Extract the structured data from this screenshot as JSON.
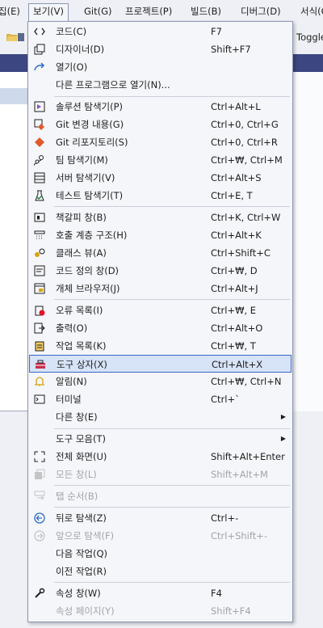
{
  "menubar": {
    "items": [
      {
        "label": "집(E)"
      },
      {
        "label": "보기(V)"
      },
      {
        "label": "Git(G)"
      },
      {
        "label": "프로젝트(P)"
      },
      {
        "label": "빌드(B)"
      },
      {
        "label": "디버그(D)"
      },
      {
        "label": "서식(O)"
      }
    ]
  },
  "toolbar": {
    "toggle_label": "Toggle"
  },
  "menu": {
    "items": [
      {
        "icon": "code-icon",
        "label": "코드(C)",
        "shortcut": "F7"
      },
      {
        "icon": "designer-icon",
        "label": "디자이너(D)",
        "shortcut": "Shift+F7"
      },
      {
        "icon": "open-icon",
        "label": "열기(O)",
        "shortcut": ""
      },
      {
        "icon": "",
        "label": "다른 프로그램으로 열기(N)...",
        "shortcut": ""
      },
      {
        "icon": "solution-explorer-icon",
        "label": "솔루션 탐색기(P)",
        "shortcut": "Ctrl+Alt+L"
      },
      {
        "icon": "git-changes-icon",
        "label": "Git 변경 내용(G)",
        "shortcut": "Ctrl+0, Ctrl+G"
      },
      {
        "icon": "git-repository-icon",
        "label": "Git 리포지토리(S)",
        "shortcut": "Ctrl+0, Ctrl+R"
      },
      {
        "icon": "team-explorer-icon",
        "label": "팀 탐색기(M)",
        "shortcut": "Ctrl+₩, Ctrl+M"
      },
      {
        "icon": "server-explorer-icon",
        "label": "서버 탐색기(V)",
        "shortcut": "Ctrl+Alt+S"
      },
      {
        "icon": "test-explorer-icon",
        "label": "테스트 탐색기(T)",
        "shortcut": "Ctrl+E, T"
      },
      {
        "icon": "bookmark-window-icon",
        "label": "책갈피 창(B)",
        "shortcut": "Ctrl+K, Ctrl+W"
      },
      {
        "icon": "call-hierarchy-icon",
        "label": "호출 계층 구조(H)",
        "shortcut": "Ctrl+Alt+K"
      },
      {
        "icon": "class-view-icon",
        "label": "클래스 뷰(A)",
        "shortcut": "Ctrl+Shift+C"
      },
      {
        "icon": "code-definition-icon",
        "label": "코드 정의 창(D)",
        "shortcut": "Ctrl+₩, D"
      },
      {
        "icon": "object-browser-icon",
        "label": "개체 브라우저(J)",
        "shortcut": "Ctrl+Alt+J"
      },
      {
        "icon": "error-list-icon",
        "label": "오류 목록(I)",
        "shortcut": "Ctrl+₩, E"
      },
      {
        "icon": "output-icon",
        "label": "출력(O)",
        "shortcut": "Ctrl+Alt+O"
      },
      {
        "icon": "task-list-icon",
        "label": "작업 목록(K)",
        "shortcut": "Ctrl+₩, T"
      },
      {
        "icon": "toolbox-icon",
        "label": "도구 상자(X)",
        "shortcut": "Ctrl+Alt+X"
      },
      {
        "icon": "notifications-icon",
        "label": "알림(N)",
        "shortcut": "Ctrl+₩, Ctrl+N"
      },
      {
        "icon": "terminal-icon",
        "label": "터미널",
        "shortcut": "Ctrl+`"
      },
      {
        "icon": "",
        "label": "다른 창(E)",
        "shortcut": ""
      },
      {
        "icon": "",
        "label": "도구 모음(T)",
        "shortcut": ""
      },
      {
        "icon": "full-screen-icon",
        "label": "전체 화면(U)",
        "shortcut": "Shift+Alt+Enter"
      },
      {
        "icon": "all-windows-icon",
        "label": "모든 창(L)",
        "shortcut": "Shift+Alt+M"
      },
      {
        "icon": "tab-order-icon",
        "label": "탭 순서(B)",
        "shortcut": ""
      },
      {
        "icon": "navigate-back-icon",
        "label": "뒤로 탐색(Z)",
        "shortcut": "Ctrl+-"
      },
      {
        "icon": "navigate-forward-icon",
        "label": "앞으로 탐색(F)",
        "shortcut": "Ctrl+Shift+-"
      },
      {
        "icon": "",
        "label": "다음 작업(Q)",
        "shortcut": ""
      },
      {
        "icon": "",
        "label": "이전 작업(R)",
        "shortcut": ""
      },
      {
        "icon": "properties-icon",
        "label": "속성 창(W)",
        "shortcut": "F4"
      },
      {
        "icon": "",
        "label": "속성 페이지(Y)",
        "shortcut": "Shift+F4"
      }
    ]
  },
  "colors": {
    "highlight_bg": "#d7e3f7",
    "highlight_border": "#3a66c9",
    "disabled_text": "#a2a4a5"
  }
}
